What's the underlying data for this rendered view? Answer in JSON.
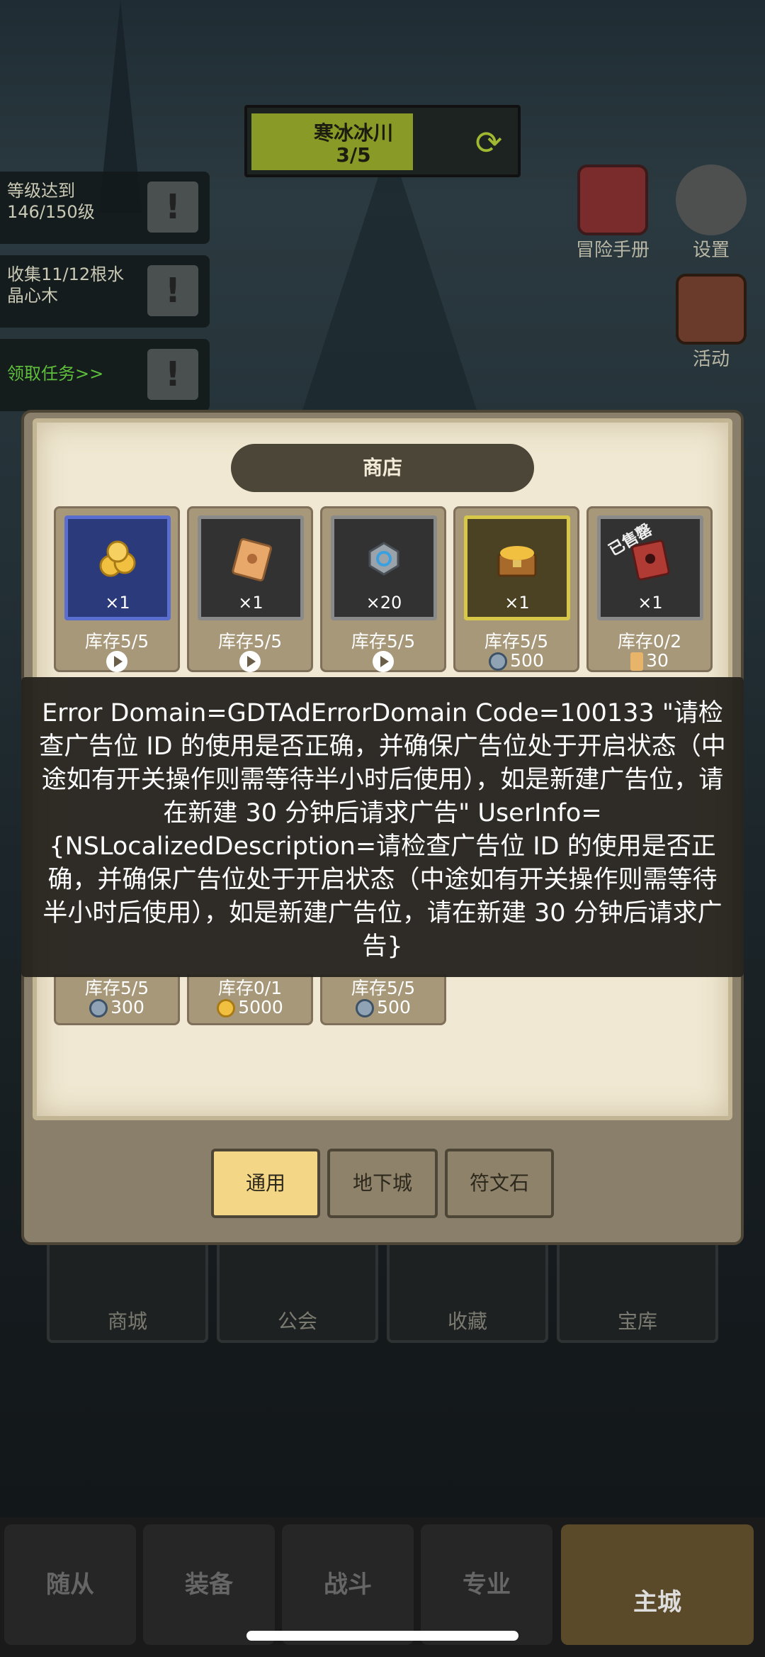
{
  "zone": {
    "name": "寒冰冰川",
    "progress": "3/5"
  },
  "quests": [
    {
      "text": "等级达到146/150级"
    },
    {
      "text": "收集11/12根水晶心木"
    },
    {
      "text": "领取任务>>"
    }
  ],
  "side_buttons": {
    "manual": "冒险手册",
    "settings": "设置",
    "activity": "活动"
  },
  "shop": {
    "title": "商店",
    "items_row1": [
      {
        "qty": "×1",
        "stock": "库存5/5",
        "price_type": "ad",
        "price": ""
      },
      {
        "qty": "×1",
        "stock": "库存5/5",
        "price_type": "ad",
        "price": ""
      },
      {
        "qty": "×20",
        "stock": "库存5/5",
        "price_type": "ad",
        "price": ""
      },
      {
        "qty": "×1",
        "stock": "库存5/5",
        "price_type": "gem",
        "price": "500"
      },
      {
        "qty": "×1",
        "stock": "库存0/2",
        "price_type": "scroll",
        "price": "30",
        "sold": "已售罄"
      }
    ],
    "items_row2": [
      {
        "stock": "库存5/5",
        "price_type": "gem",
        "price": "300"
      },
      {
        "stock": "库存0/1",
        "price_type": "gold",
        "price": "5000"
      },
      {
        "stock": "库存5/5",
        "price_type": "gem",
        "price": "500"
      }
    ],
    "categories": [
      "通用",
      "地下城",
      "符文石"
    ]
  },
  "error_message": "Error Domain=GDTAdErrorDomain Code=100133 \"请检查广告位 ID 的使用是否正确，并确保广告位处于开启状态（中途如有开关操作则需等待半小时后使用），如是新建广告位，请在新建 30 分钟后请求广告\" UserInfo={NSLocalizedDescription=请检查广告位 ID 的使用是否正确，并确保广告位处于开启状态（中途如有开关操作则需等待半小时后使用），如是新建广告位，请在新建 30 分钟后请求广告}",
  "dock": [
    "商城",
    "公会",
    "收藏",
    "宝库"
  ],
  "nav": [
    "随从",
    "装备",
    "战斗",
    "专业",
    "主城"
  ]
}
